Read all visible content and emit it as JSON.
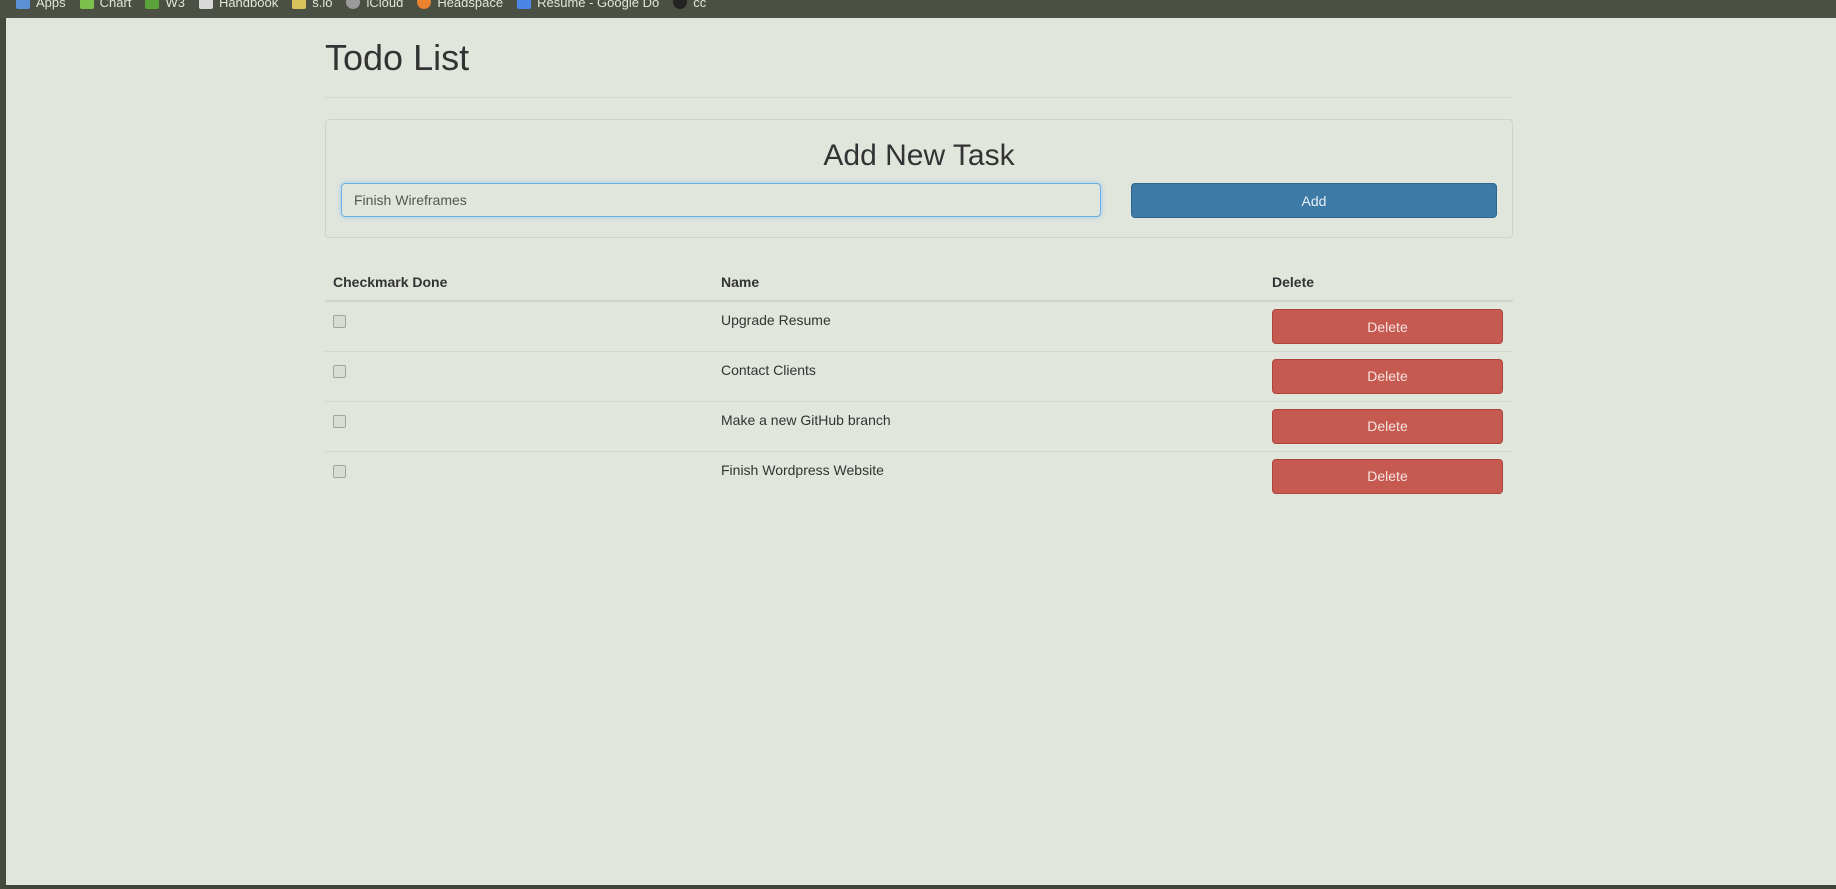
{
  "bookmarks": [
    {
      "label": "Apps",
      "icon": "apps-grid-icon",
      "color": "#5b8fd6"
    },
    {
      "label": "Chart",
      "icon": "chart-icon",
      "color": "#7cc04b"
    },
    {
      "label": "W3",
      "icon": "w3-icon",
      "color": "#5aa23a"
    },
    {
      "label": "Handbook",
      "icon": "handbook-icon",
      "color": "#d9d9d9"
    },
    {
      "label": "s.io",
      "icon": "sio-icon",
      "color": "#d8c25a"
    },
    {
      "label": "iCloud",
      "icon": "apple-icon",
      "color": "#9a9a9a"
    },
    {
      "label": "Headspace",
      "icon": "headspace-icon",
      "color": "#e8822e"
    },
    {
      "label": "Resume - Google Do",
      "icon": "google-docs-icon",
      "color": "#4a86e8"
    },
    {
      "label": "cc",
      "icon": "github-icon",
      "color": "#222222"
    }
  ],
  "page": {
    "title": "Todo List"
  },
  "add_panel": {
    "title": "Add New Task",
    "input_value": "Finish Wireframes",
    "add_label": "Add"
  },
  "table": {
    "headers": [
      "Checkmark Done",
      "Name",
      "Delete"
    ],
    "rows": [
      {
        "done": false,
        "name": "Upgrade Resume",
        "delete_label": "Delete"
      },
      {
        "done": false,
        "name": "Contact Clients",
        "delete_label": "Delete"
      },
      {
        "done": false,
        "name": "Make a new GitHub branch",
        "delete_label": "Delete"
      },
      {
        "done": false,
        "name": "Finish Wordpress Website",
        "delete_label": "Delete"
      }
    ]
  },
  "colors": {
    "add_button": "#3d7aa6",
    "delete_button": "#c75a50",
    "page_background": "#e1e6dd"
  }
}
